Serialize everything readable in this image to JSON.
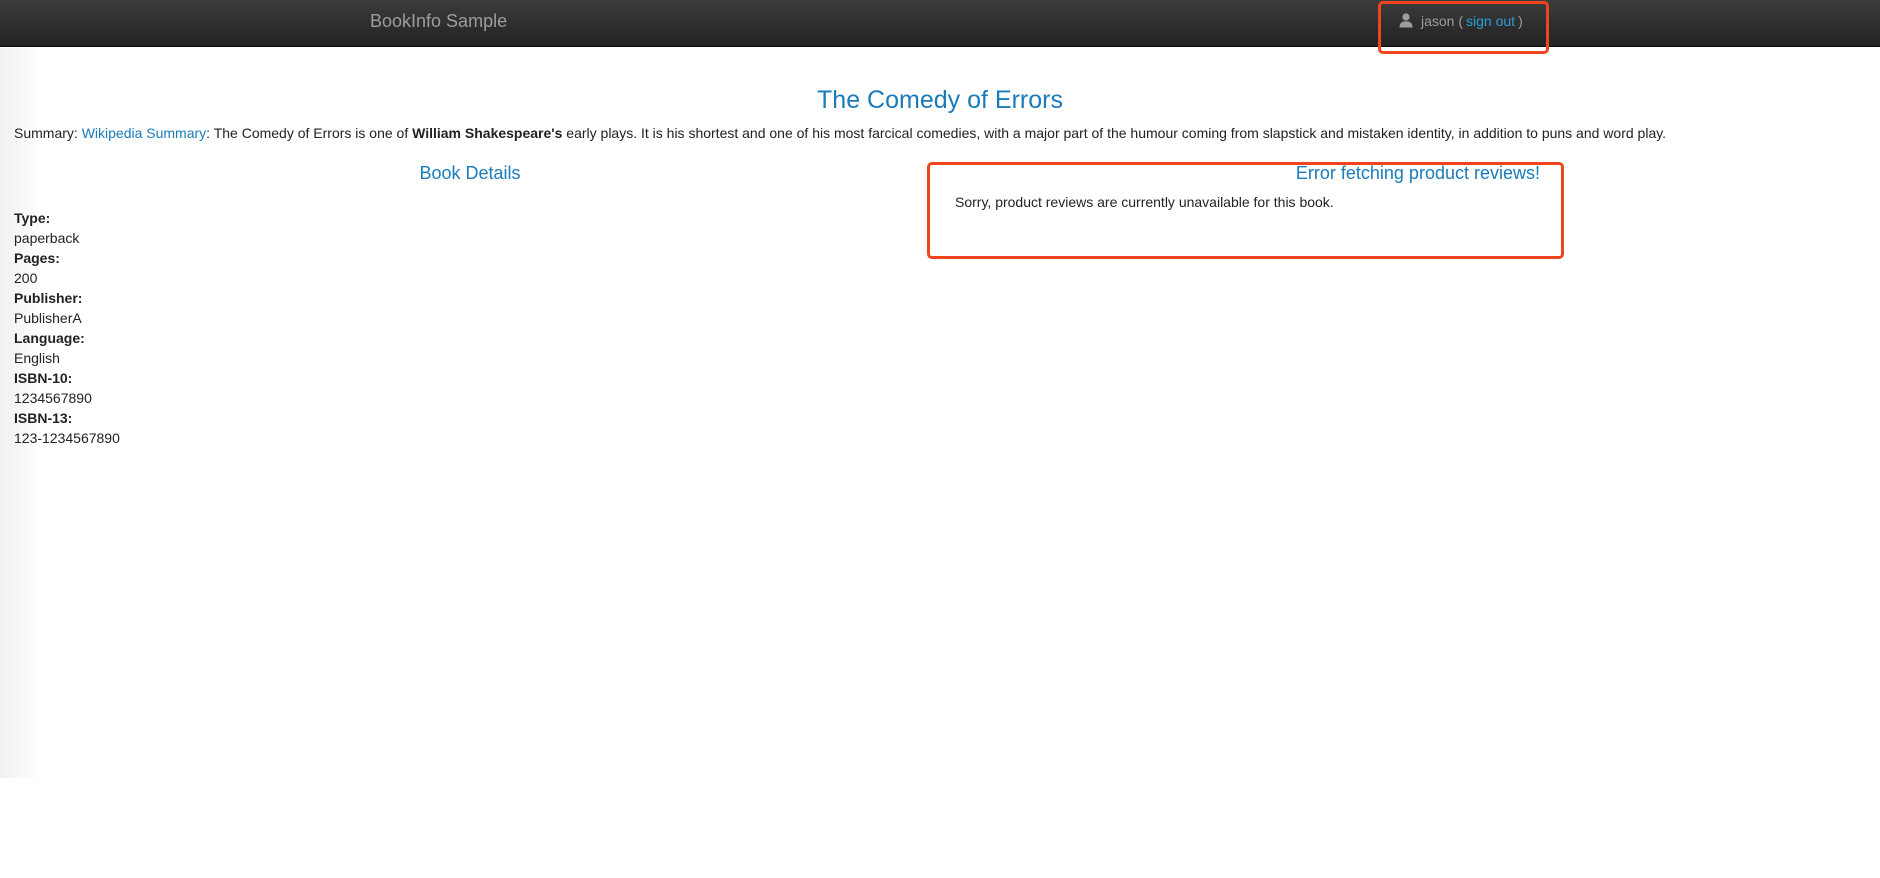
{
  "navbar": {
    "brand": "BookInfo Sample",
    "user": {
      "icon": "user-icon",
      "prefix": "jason (",
      "signout_label": "sign out",
      "suffix": ")"
    }
  },
  "book": {
    "title": "The Comedy of Errors",
    "summary": {
      "label": "Summary:",
      "link_text": "Wikipedia Summary",
      "text_before_author": ": The Comedy of Errors is one of",
      "author": "William Shakespeare's",
      "text_after_author": "early plays. It is his shortest and one of his most farcical comedies, with a major part of the humour coming from slapstick and mistaken identity, in addition to puns and word play."
    }
  },
  "details": {
    "heading": "Book Details",
    "items": [
      {
        "label": "Type:",
        "value": "paperback"
      },
      {
        "label": "Pages:",
        "value": "200"
      },
      {
        "label": "Publisher:",
        "value": "PublisherA"
      },
      {
        "label": "Language:",
        "value": "English"
      },
      {
        "label": "ISBN-10:",
        "value": "1234567890"
      },
      {
        "label": "ISBN-13:",
        "value": "123-1234567890"
      }
    ]
  },
  "reviews": {
    "heading": "Error fetching product reviews!",
    "message": "Sorry, product reviews are currently unavailable for this book."
  },
  "colors": {
    "accent": "#1a7bb9",
    "link": "#2a9fd6",
    "highlight": "#f0441f",
    "navbar": "#222222"
  }
}
